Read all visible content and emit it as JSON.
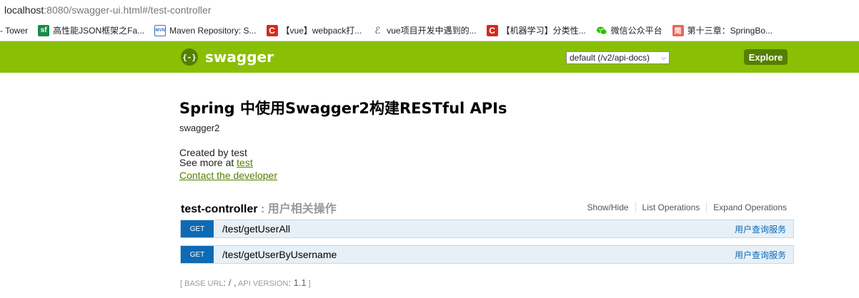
{
  "address": {
    "host": "localhost",
    "rest": ":8080/swagger-ui.html#/test-controller"
  },
  "bookmarks": [
    {
      "icon": "tower-icon",
      "label": "- Tower"
    },
    {
      "icon": "sf-icon",
      "icon_text": "sf",
      "label": "高性能JSON框架之Fa..."
    },
    {
      "icon": "mvn-icon",
      "icon_text": "MVN",
      "label": "Maven Repository: S..."
    },
    {
      "icon": "csdn-icon",
      "icon_text": "C",
      "label": "【vue】webpack打..."
    },
    {
      "icon": "vue-icon",
      "icon_text": "ℰ",
      "label": "vue项目开发中遇到的..."
    },
    {
      "icon": "csdn-icon",
      "icon_text": "C",
      "label": "【机器学习】分类性..."
    },
    {
      "icon": "wechat-icon",
      "icon_text": "",
      "label": "微信公众平台"
    },
    {
      "icon": "jianshu-icon",
      "icon_text": "简",
      "label": "第十三章：SpringBo..."
    }
  ],
  "header": {
    "logo_mark": "{-}",
    "logo_text": "swagger",
    "api_select": "default (/v2/api-docs)",
    "explore_label": "Explore",
    "colors": {
      "bar": "#89bf04",
      "button": "#547f00"
    }
  },
  "info": {
    "title": "Spring 中使用Swagger2构建RESTful APIs",
    "subtitle": "swagger2",
    "created_by": "Created by test",
    "see_more_prefix": "See more at ",
    "see_more_link": "test",
    "contact": "Contact the developer"
  },
  "resource": {
    "name": "test-controller",
    "separator": " : ",
    "description": "用户相关操作",
    "actions": [
      "Show/Hide",
      "List Operations",
      "Expand Operations"
    ],
    "operations": [
      {
        "method": "GET",
        "path": "/test/getUserAll",
        "summary": "用户查询服务"
      },
      {
        "method": "GET",
        "path": "/test/getUserByUsername",
        "summary": "用户查询服务"
      }
    ]
  },
  "footer": {
    "open": "[ BASE URL",
    "base_url": ": / ,",
    "api_version_label": " API VERSION",
    "api_version": ": 1.1",
    "close": " ]"
  }
}
